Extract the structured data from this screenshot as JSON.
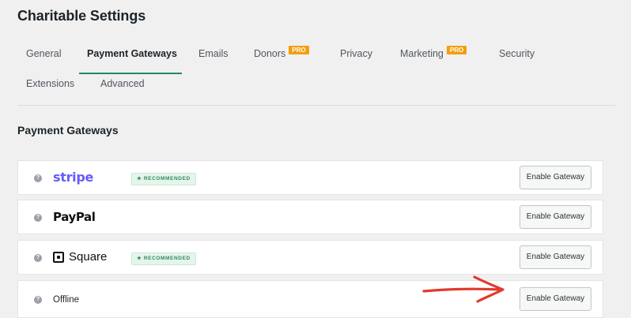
{
  "page": {
    "title": "Charitable Settings"
  },
  "tabs": [
    {
      "label": "General"
    },
    {
      "label": "Payment Gateways",
      "active": true
    },
    {
      "label": "Emails"
    },
    {
      "label": "Donors",
      "badge": "PRO"
    },
    {
      "label": "Privacy"
    },
    {
      "label": "Marketing",
      "badge": "PRO"
    },
    {
      "label": "Security"
    },
    {
      "label": "Extensions"
    },
    {
      "label": "Advanced"
    }
  ],
  "section": {
    "title": "Payment Gateways"
  },
  "gateways": [
    {
      "name": "stripe",
      "badge": "★ RECOMMENDED",
      "button": "Enable Gateway",
      "help": "?"
    },
    {
      "name": "PayPal",
      "button": "Enable Gateway",
      "help": "?"
    },
    {
      "name": "Square",
      "badge": "★ RECOMMENDED",
      "button": "Enable Gateway",
      "help": "?"
    },
    {
      "name": "Offline",
      "button": "Enable Gateway",
      "help": "?"
    }
  ],
  "colors": {
    "accent": "#1e8a5f",
    "pro_badge": "#f59e0b",
    "stripe": "#635bff",
    "recommended_text": "#2f8a5b",
    "annotation_arrow": "#e23a2e"
  },
  "icons": {
    "help": "question-mark-circle",
    "square_logo": "square-logo",
    "annotation": "hand-drawn-arrow"
  }
}
